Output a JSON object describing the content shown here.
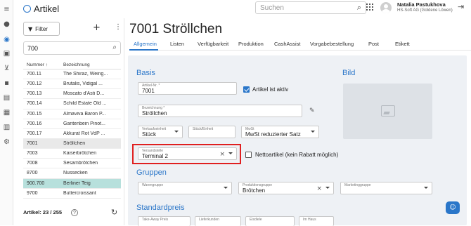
{
  "topbar": {
    "app_title": "Artikel",
    "search_placeholder": "Suchen",
    "user_name": "Natalia Pastukhova",
    "user_company": "HS-Soft AG (Goldene Löwen)"
  },
  "left": {
    "filter_label": "Filter",
    "search_value": "700",
    "columns": [
      "Nummer",
      "Bezeichnung"
    ],
    "sort_indicator": "↑",
    "rows": [
      {
        "num": "700.11",
        "name": "The Shiraz, Weing..."
      },
      {
        "num": "700.12",
        "name": "Brutalis, Vidigal ..."
      },
      {
        "num": "700.13",
        "name": "Moscato d'Asti D..."
      },
      {
        "num": "700.14",
        "name": "Schild Estate Old ..."
      },
      {
        "num": "700.15",
        "name": "Almaviva Baron P..."
      },
      {
        "num": "700.16",
        "name": "Gantenbein Pinot..."
      },
      {
        "num": "700.17",
        "name": "Akkurat Rot VdP ..."
      },
      {
        "num": "7001",
        "name": "Ströllchen"
      },
      {
        "num": "7003",
        "name": "Kaiserbrötchen"
      },
      {
        "num": "7008",
        "name": "Sesambrötchen"
      },
      {
        "num": "8700",
        "name": "Nussecken"
      },
      {
        "num": "900.700",
        "name": "Berliner Teig"
      },
      {
        "num": "9700",
        "name": "Buttercroissant"
      }
    ],
    "footer": "Artikel: 23 / 255"
  },
  "main": {
    "title": "7001 Ströllchen",
    "tabs": [
      "Allgemein",
      "Listen",
      "Verfügbarkeit",
      "Produktion",
      "CashAssist",
      "Vorgabebestellung",
      "Post",
      "Etikett"
    ],
    "sections": {
      "basis": "Basis",
      "bild": "Bild",
      "gruppen": "Gruppen",
      "standardpreis": "Standardpreis"
    },
    "fields": {
      "artikel_nr": {
        "label": "Artikel-Nr. *",
        "value": "7001"
      },
      "artikel_aktiv": "Artikel ist aktiv",
      "bezeichnung": {
        "label": "Bezeichnung *",
        "value": "Ströllchen"
      },
      "verkaufseinheit": {
        "label": "Verkaufseinheit",
        "value": "Stück"
      },
      "stueck_einheit": {
        "label": "Stück/Einheit",
        "value": ""
      },
      "mwst": {
        "label": "MwSt",
        "value": "MwSt reduzierter Satz"
      },
      "versandstelle": {
        "label": "Versandstelle",
        "value": "Terminal 2"
      },
      "nettoartikel": "Nettoartikel (kein Rabatt möglich)",
      "warengruppe": {
        "label": "Warengruppe",
        "value": ""
      },
      "produktionsgruppe": {
        "label": "Produktionsgruppe",
        "value": "Brötchen"
      },
      "marketinggruppe": {
        "label": "Marketinggruppe",
        "value": ""
      },
      "price_labels": [
        "Take-Away Preis",
        "Lieferkunden",
        "Eisdiele",
        "Im Haus"
      ]
    }
  }
}
